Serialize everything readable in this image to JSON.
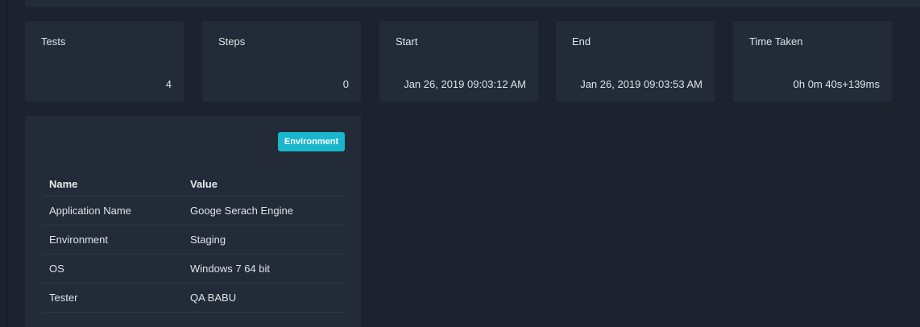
{
  "summary": {
    "tests": {
      "label": "Tests",
      "value": "4"
    },
    "steps": {
      "label": "Steps",
      "value": "0"
    },
    "start": {
      "label": "Start",
      "value": "Jan 26, 2019 09:03:12 AM"
    },
    "end": {
      "label": "End",
      "value": "Jan 26, 2019 09:03:53 AM"
    },
    "time_taken": {
      "label": "Time Taken",
      "value": "0h 0m 40s+139ms"
    }
  },
  "environment": {
    "badge": "Environment",
    "headers": {
      "name": "Name",
      "value": "Value"
    },
    "rows": [
      {
        "name": "Application Name",
        "value": "Googe Serach Engine"
      },
      {
        "name": "Environment",
        "value": "Staging"
      },
      {
        "name": "OS",
        "value": "Windows 7 64 bit"
      },
      {
        "name": "Tester",
        "value": "QA BABU"
      }
    ]
  },
  "colors": {
    "background": "#1c232e",
    "card": "#222b37",
    "badge": "#19b6cd"
  }
}
